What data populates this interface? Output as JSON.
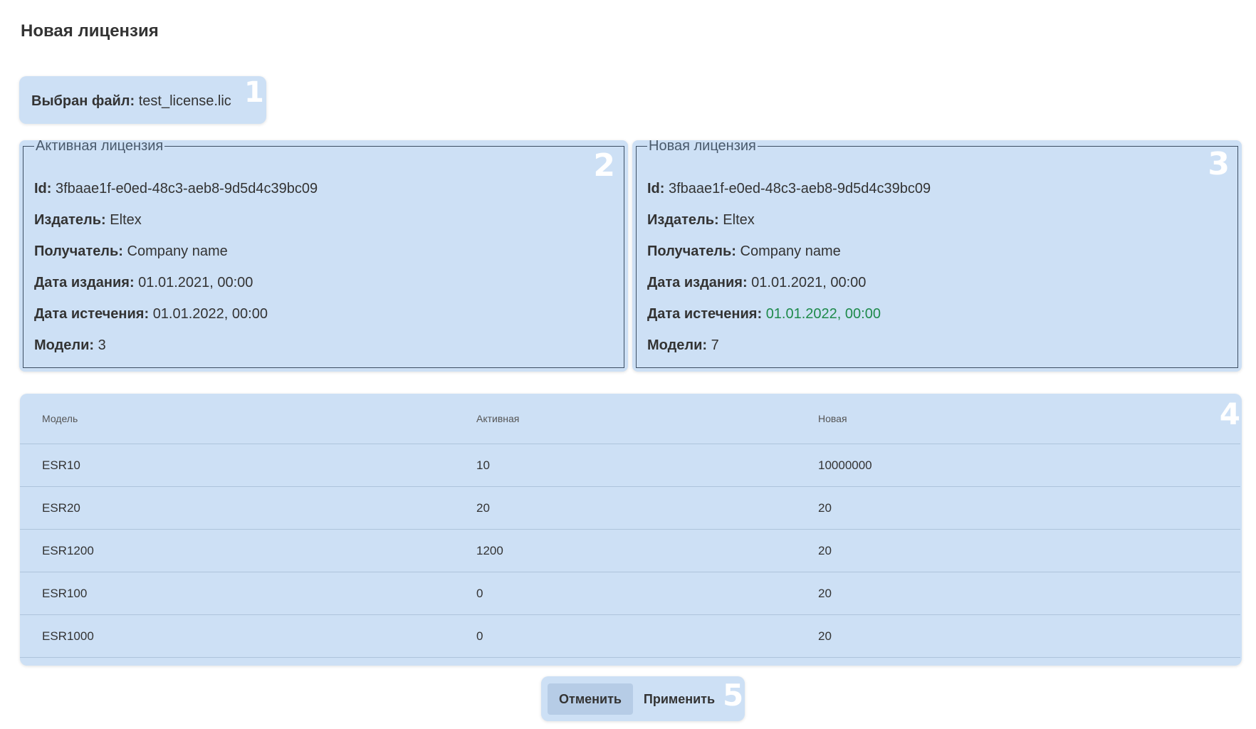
{
  "page": {
    "title": "Новая лицензия"
  },
  "file": {
    "label": "Выбран файл:",
    "value": "test_license.lic",
    "marker": "1"
  },
  "active_license": {
    "legend": "Активная лицензия",
    "marker": "2",
    "rows": [
      {
        "label": "Id:",
        "value": "3fbaae1f-e0ed-48c3-aeb8-9d5d4c39bc09"
      },
      {
        "label": "Издатель:",
        "value": "Eltex"
      },
      {
        "label": "Получатель:",
        "value": "Company name"
      },
      {
        "label": "Дата издания:",
        "value": "01.01.2021, 00:00"
      },
      {
        "label": "Дата истечения:",
        "value": "01.01.2022, 00:00"
      },
      {
        "label": "Модели:",
        "value": "3"
      }
    ]
  },
  "new_license": {
    "legend": "Новая лицензия",
    "marker": "3",
    "rows": [
      {
        "label": "Id:",
        "value": "3fbaae1f-e0ed-48c3-aeb8-9d5d4c39bc09"
      },
      {
        "label": "Издатель:",
        "value": "Eltex"
      },
      {
        "label": "Получатель:",
        "value": "Company name"
      },
      {
        "label": "Дата издания:",
        "value": "01.01.2021, 00:00"
      },
      {
        "label": "Дата истечения:",
        "value": "01.01.2022, 00:00"
      },
      {
        "label": "Модели:",
        "value": "7"
      }
    ],
    "highlight_color": "#1e8a4b"
  },
  "models_table": {
    "marker": "4",
    "columns": [
      "Модель",
      "Активная",
      "Новая"
    ],
    "rows": [
      [
        "ESR10",
        "10",
        "10000000"
      ],
      [
        "ESR20",
        "20",
        "20"
      ],
      [
        "ESR1200",
        "1200",
        "20"
      ],
      [
        "ESR100",
        "0",
        "20"
      ],
      [
        "ESR1000",
        "0",
        "20"
      ]
    ]
  },
  "actions": {
    "cancel_label": "Отменить",
    "apply_label": "Применить",
    "marker": "5"
  },
  "colors": {
    "panel_bg": "#cde0f5",
    "cancel_bg": "#b6cce6",
    "marker": "#ffffff"
  }
}
